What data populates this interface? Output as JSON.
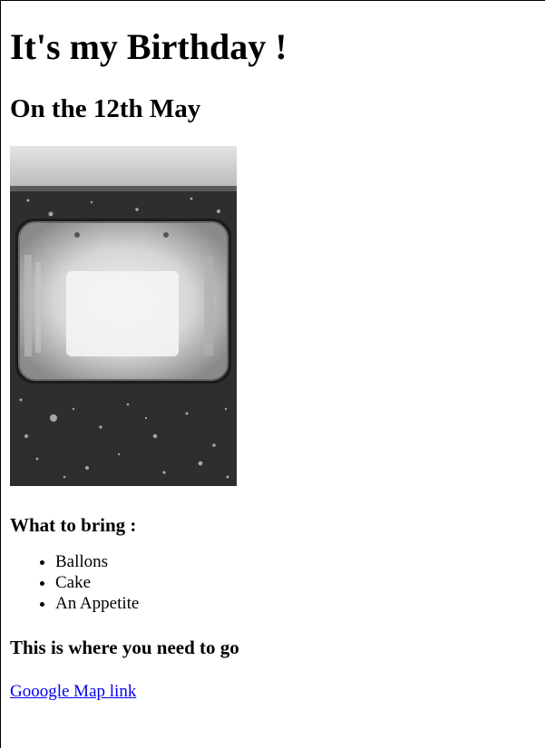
{
  "page": {
    "title": "It's my Birthday !",
    "subtitle": "On the 12th May",
    "bring_heading": "What to bring :",
    "bring_items": [
      "Ballons",
      "Cake",
      "An Appetite"
    ],
    "directions_heading": "This is where you need to go",
    "map_link_label": "Gooogle Map link",
    "image_icon": "train-window-photo"
  }
}
